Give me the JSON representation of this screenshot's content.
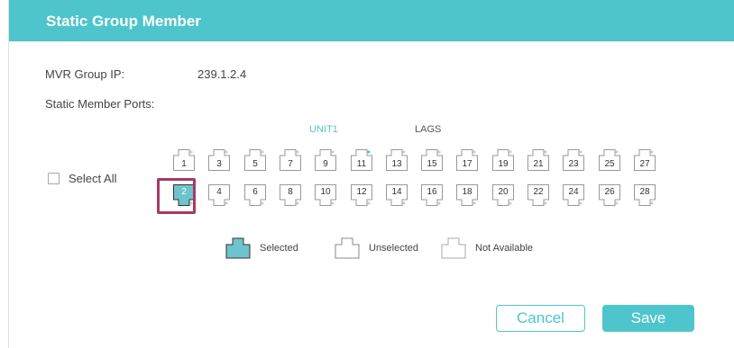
{
  "dialog": {
    "title": "Static Group Member",
    "mvr_group_ip_label": "MVR Group IP:",
    "mvr_group_ip_value": "239.1.2.4",
    "static_member_ports_label": "Static Member Ports:"
  },
  "tabs": [
    {
      "label": "UNIT1",
      "active": true
    },
    {
      "label": "LAGS",
      "active": false
    }
  ],
  "select_all": {
    "label": "Select All",
    "checked": false
  },
  "ports_top": [
    "1",
    "3",
    "5",
    "7",
    "9",
    "11",
    "13",
    "15",
    "17",
    "19",
    "21",
    "23",
    "25",
    "27"
  ],
  "ports_bottom": [
    "2",
    "4",
    "6",
    "8",
    "10",
    "12",
    "14",
    "16",
    "18",
    "20",
    "22",
    "24",
    "26",
    "28"
  ],
  "selected_ports": [
    "2"
  ],
  "legend": {
    "selected": "Selected",
    "unselected": "Unselected",
    "not_available": "Not Available"
  },
  "buttons": {
    "cancel": "Cancel",
    "save": "Save"
  },
  "colors": {
    "accent": "#4ec5cd",
    "highlight": "#a63a66"
  }
}
